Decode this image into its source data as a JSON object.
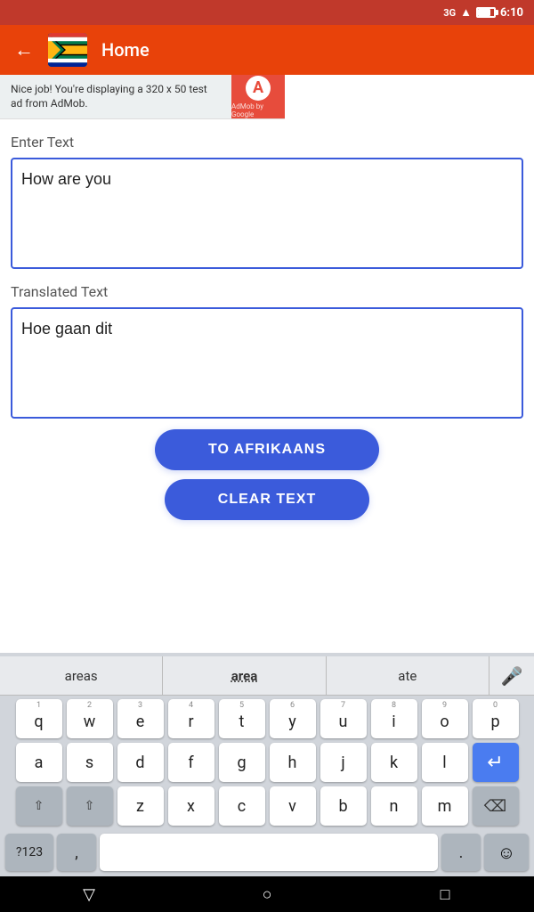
{
  "statusBar": {
    "signal": "3G",
    "time": "6:10"
  },
  "appBar": {
    "title": "Home",
    "backLabel": "←"
  },
  "adBanner": {
    "text": "Nice job! You're displaying a 320 x 50 test ad from AdMob.",
    "logoText": "A",
    "byText": "AdMob by Google"
  },
  "inputSection": {
    "label": "Enter Text",
    "placeholder": "",
    "value": "How are you"
  },
  "translatedSection": {
    "label": "Translated Text",
    "value": "Hoe gaan dit"
  },
  "buttons": {
    "translateLabel": "TO AFRIKAANS",
    "clearLabel": "CLEAR TEXT"
  },
  "keyboard": {
    "suggestions": [
      "areas",
      "area",
      "ate"
    ],
    "rows": [
      [
        {
          "num": "1",
          "letter": "q"
        },
        {
          "num": "2",
          "letter": "w"
        },
        {
          "num": "3",
          "letter": "e"
        },
        {
          "num": "4",
          "letter": "r"
        },
        {
          "num": "5",
          "letter": "t"
        },
        {
          "num": "6",
          "letter": "y"
        },
        {
          "num": "7",
          "letter": "u"
        },
        {
          "num": "8",
          "letter": "i"
        },
        {
          "num": "9",
          "letter": "o"
        },
        {
          "num": "0",
          "letter": "p"
        }
      ],
      [
        {
          "num": "",
          "letter": "a"
        },
        {
          "num": "",
          "letter": "s"
        },
        {
          "num": "",
          "letter": "d"
        },
        {
          "num": "",
          "letter": "f"
        },
        {
          "num": "",
          "letter": "g"
        },
        {
          "num": "",
          "letter": "h"
        },
        {
          "num": "",
          "letter": "j"
        },
        {
          "num": "",
          "letter": "k"
        },
        {
          "num": "",
          "letter": "l"
        }
      ],
      [
        {
          "num": "",
          "letter": "z"
        },
        {
          "num": "",
          "letter": "x"
        },
        {
          "num": "",
          "letter": "c"
        },
        {
          "num": "",
          "letter": "v"
        },
        {
          "num": "",
          "letter": "b"
        },
        {
          "num": "",
          "letter": "n"
        },
        {
          "num": "",
          "letter": "m"
        },
        {
          "num": "",
          "letter": "!"
        },
        {
          "num": "",
          "letter": "?"
        }
      ]
    ],
    "bottomRow": {
      "symLabel": "?123",
      "commaLabel": ",",
      "spacePlaceholder": "",
      "periodLabel": ".",
      "emojiLabel": "☺"
    }
  },
  "navBar": {
    "backIcon": "▽",
    "homeIcon": "○",
    "recentIcon": "□"
  }
}
